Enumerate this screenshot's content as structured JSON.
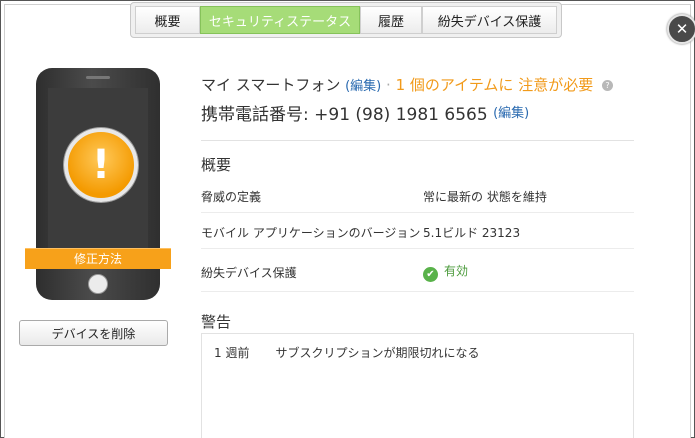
{
  "tabs": [
    {
      "label": "概要",
      "active": false
    },
    {
      "label": "セキュリティステータス",
      "active": true
    },
    {
      "label": "履歴",
      "active": false
    },
    {
      "label": "紛失デバイス保護",
      "active": false
    }
  ],
  "close_icon": "close-icon",
  "device": {
    "alert_icon": "exclamation-icon",
    "alert_glyph": "!",
    "fix_label": "修正方法",
    "remove_button": "デバイスを削除"
  },
  "header": {
    "device_name": "マイ スマートフォン",
    "edit_label": "(編集)",
    "separator": "·",
    "warning": "1 個のアイテムに 注意が必要",
    "help_icon": "help-icon",
    "phone_label": "携帯電話番号: +91 (98) 1981 6565",
    "phone_edit_label": "(編集)"
  },
  "overview": {
    "title": "概要",
    "rows": [
      {
        "key": "脅威の定義",
        "value": "常に最新の 状態を維持"
      },
      {
        "key": "モバイル アプリケーションのバージョン",
        "value": "5.1ビルド 23123"
      },
      {
        "key": "紛失デバイス保護",
        "value": "有効",
        "status": "ok"
      }
    ]
  },
  "warnings": {
    "title": "警告",
    "items": [
      {
        "time": "1 週前",
        "description": "サブスクリプションが期限切れになる"
      }
    ]
  },
  "colors": {
    "accent_green": "#a6dc78",
    "warning_orange": "#f19a1a",
    "link_blue": "#2a6ab0",
    "ok_green": "#59b24a"
  }
}
